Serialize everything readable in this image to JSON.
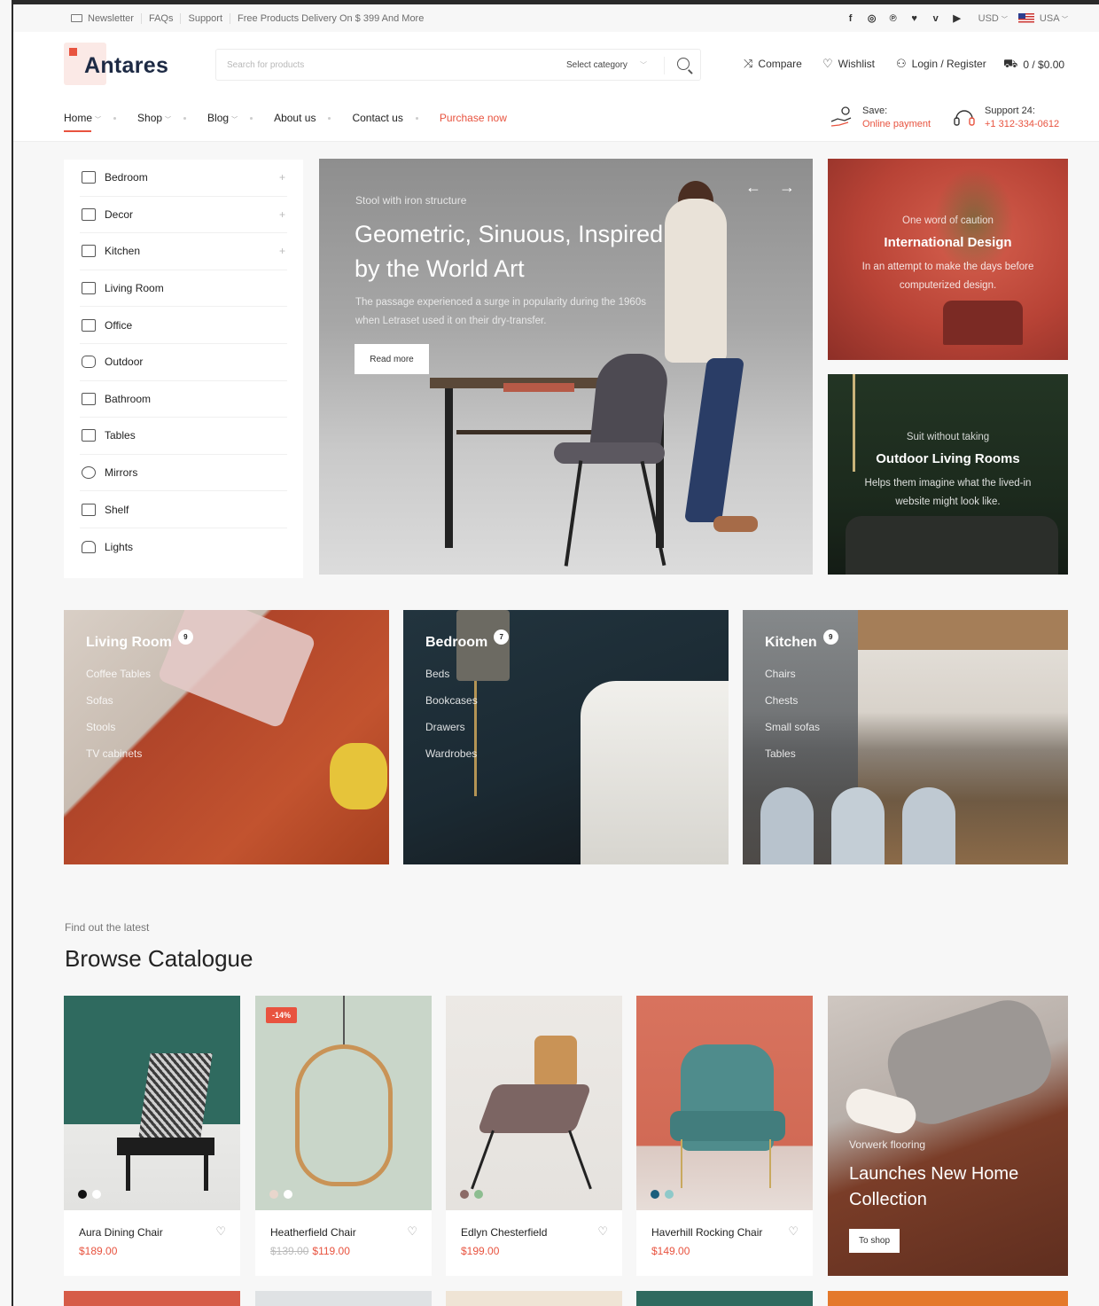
{
  "topbar": {
    "links": [
      "Newsletter",
      "FAQs",
      "Support",
      "Free Products Delivery On $ 399 And More"
    ],
    "social": [
      "f",
      "◎",
      "℗",
      "♥",
      "v",
      "▶"
    ],
    "currency": "USD",
    "country": "USA"
  },
  "header": {
    "logo_text": "Antares",
    "search_placeholder": "Search for products",
    "category_label": "Select category",
    "compare": "Compare",
    "wishlist": "Wishlist",
    "login": "Login / Register",
    "cart": "0 / $0.00"
  },
  "nav": {
    "items": [
      "Home",
      "Shop",
      "Blog",
      "About us",
      "Contact us",
      "Purchase now"
    ],
    "save_label": "Save:",
    "save_value": "Online payment",
    "support_label": "Support 24:",
    "support_value": "+1 312-334-0612"
  },
  "sidebar": {
    "items": [
      "Bedroom",
      "Decor",
      "Kitchen",
      "Living Room",
      "Office",
      "Outdoor",
      "Bathroom",
      "Tables",
      "Mirrors",
      "Shelf",
      "Lights"
    ]
  },
  "hero": {
    "subtitle": "Stool with iron structure",
    "title": "Geometric, Sinuous, Inspired by the World Art",
    "description": "The passage experienced a surge in popularity during the 1960s when Letraset used it on their dry-transfer.",
    "button": "Read more"
  },
  "promos": [
    {
      "subtitle": "One word of caution",
      "title": "International Design",
      "description": "In an attempt to make the days before computerized design."
    },
    {
      "subtitle": "Suit without taking",
      "title": "Outdoor Living Rooms",
      "description": "Helps them imagine what the lived-in website might look like."
    }
  ],
  "categories": [
    {
      "title": "Living Room",
      "count": "9",
      "items": [
        "Coffee Tables",
        "Sofas",
        "Stools",
        "TV cabinets"
      ]
    },
    {
      "title": "Bedroom",
      "count": "7",
      "items": [
        "Beds",
        "Bookcases",
        "Drawers",
        "Wardrobes"
      ]
    },
    {
      "title": "Kitchen",
      "count": "9",
      "items": [
        "Chairs",
        "Chests",
        "Small sofas",
        "Tables"
      ]
    }
  ],
  "catalogue": {
    "subtitle": "Find out the latest",
    "title": "Browse Catalogue",
    "products": [
      {
        "name": "Aura Dining Chair",
        "price": "$189.00",
        "old_price": ""
      },
      {
        "name": "Heatherfield Chair",
        "price": "$119.00",
        "old_price": "$139.00",
        "badge": "-14%"
      },
      {
        "name": "Edlyn Chesterfield",
        "price": "$199.00",
        "old_price": ""
      },
      {
        "name": "Haverhill Rocking Chair",
        "price": "$149.00",
        "old_price": ""
      }
    ],
    "promo": {
      "subtitle": "Vorwerk flooring",
      "title": "Launches New Home Collection",
      "button": "To shop"
    }
  },
  "colors": {
    "accent": "#e8533f",
    "dark": "#1d2a44"
  }
}
